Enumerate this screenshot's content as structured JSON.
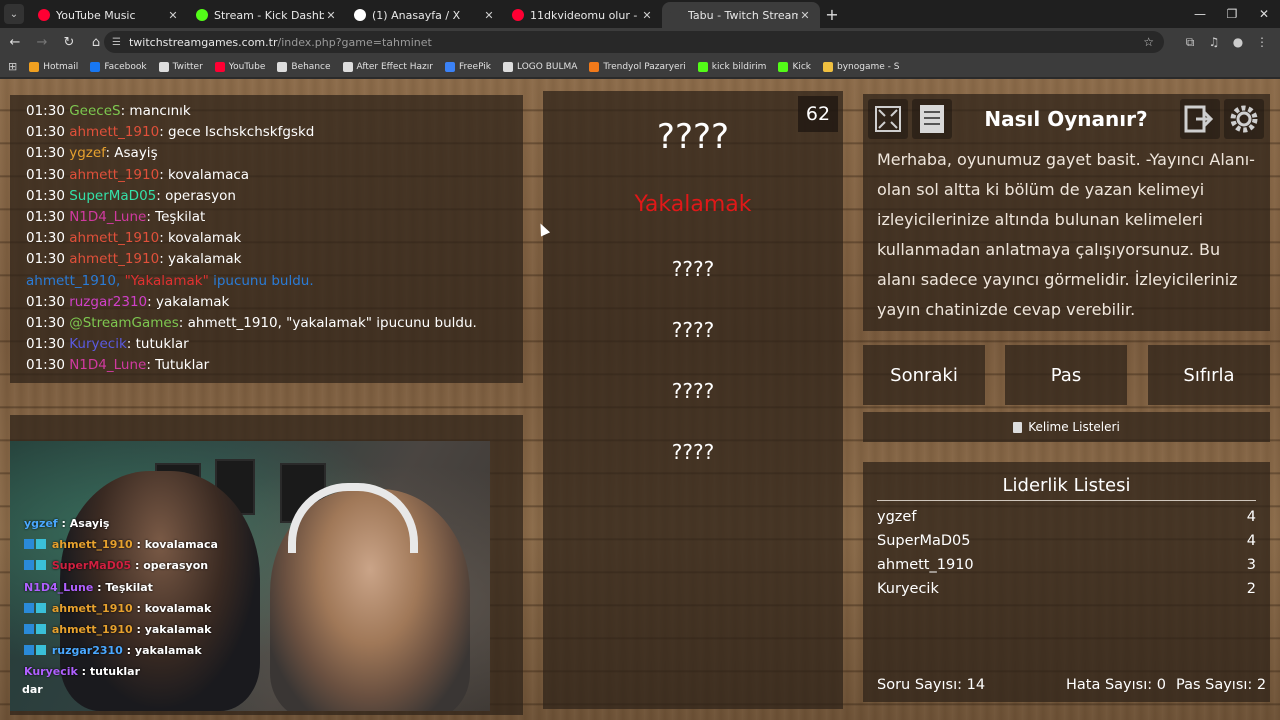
{
  "browser": {
    "tabs": [
      {
        "title": "YouTube Music",
        "color": "#ff0033",
        "active": false
      },
      {
        "title": "Stream - Kick Dashboard",
        "color": "#53fc18",
        "active": false
      },
      {
        "title": "(1) Anasayfa / X",
        "color": "#ffffff",
        "active": false
      },
      {
        "title": "11dkvideomu olur - YouTube",
        "color": "#ff0033",
        "active": false
      },
      {
        "title": "Tabu - Twitch Stream Games",
        "color": "#3c3c3c",
        "active": true
      }
    ],
    "url_host": "twitchstreamgames.com.tr",
    "url_path": "/index.php?game=tahminet",
    "bookmarks": [
      {
        "label": "Hotmail",
        "color": "#f0a020"
      },
      {
        "label": "Facebook",
        "color": "#1877f2"
      },
      {
        "label": "Twitter",
        "color": "#dddddd"
      },
      {
        "label": "YouTube",
        "color": "#ff0033"
      },
      {
        "label": "Behance",
        "color": "#dddddd"
      },
      {
        "label": "After Effect Hazır",
        "color": "#dddddd"
      },
      {
        "label": "FreePik",
        "color": "#3b82f6"
      },
      {
        "label": "LOGO BULMA",
        "color": "#dddddd"
      },
      {
        "label": "Trendyol Pazaryeri",
        "color": "#f27a1a"
      },
      {
        "label": "kick bildirim",
        "color": "#53fc18"
      },
      {
        "label": "Kick",
        "color": "#53fc18"
      },
      {
        "label": "bynogame - S",
        "color": "#f0c040"
      }
    ]
  },
  "chat_log": [
    {
      "time": "01:30",
      "user": "GeeceS",
      "color": "#7ec850",
      "message": "mancınık"
    },
    {
      "time": "01:30",
      "user": "ahmett_1910",
      "color": "#e0503a",
      "message": "gece Ischskchskfgskd"
    },
    {
      "time": "01:30",
      "user": "ygzef",
      "color": "#e6a12e",
      "message": "Asayiş"
    },
    {
      "time": "01:30",
      "user": "ahmett_1910",
      "color": "#e0503a",
      "message": "kovalamaca"
    },
    {
      "time": "01:30",
      "user": "SuperMaD05",
      "color": "#34e0a8",
      "message": "operasyon"
    },
    {
      "time": "01:30",
      "user": "N1D4_Lune",
      "color": "#d03aa0",
      "message": "Teşkilat"
    },
    {
      "time": "01:30",
      "user": "ahmett_1910",
      "color": "#e0503a",
      "message": "kovalamak"
    },
    {
      "time": "01:30",
      "user": "ahmett_1910",
      "color": "#e0503a",
      "message": "yakalamak"
    }
  ],
  "chat_system": {
    "user": "ahmett_1910,",
    "quote": "\"Yakalamak\"",
    "rest": "ipucunu buldu."
  },
  "chat_log_after": [
    {
      "time": "01:30",
      "user": "ruzgar2310",
      "color": "#d040c8",
      "message": "yakalamak"
    },
    {
      "time": "01:30",
      "user": "@StreamGames",
      "color": "#7ec850",
      "message": "ahmett_1910, \"yakalamak\" ipucunu buldu."
    },
    {
      "time": "01:30",
      "user": "Kuryecik",
      "color": "#5a5ae0",
      "message": "tutuklar"
    },
    {
      "time": "01:30",
      "user": "N1D4_Lune",
      "color": "#d03aa0",
      "message": "Tutuklar"
    }
  ],
  "webcam_chat": [
    {
      "user": "ygzef",
      "color": "#4aa8ff",
      "message": "Asayiş"
    },
    {
      "user": "ahmett_1910",
      "color": "#e6a12e",
      "message": "kovalamaca"
    },
    {
      "user": "SuperMaD05",
      "color": "#d02040",
      "message": "operasyon"
    },
    {
      "user": "N1D4_Lune",
      "color": "#b060ff",
      "message": "Teşkilat"
    },
    {
      "user": "ahmett_1910",
      "color": "#e6a12e",
      "message": "kovalamak"
    },
    {
      "user": "ahmett_1910",
      "color": "#e6a12e",
      "message": "yakalamak"
    },
    {
      "user": "ruzgar2310",
      "color": "#4aa8ff",
      "message": "yakalamak"
    },
    {
      "user": "Kuryecik",
      "color": "#b060ff",
      "message": "tutuklar"
    }
  ],
  "webcam_tail": "dar",
  "card": {
    "timer": "62",
    "main_word": "????",
    "hints": [
      "Yakalamak",
      "????",
      "????",
      "????",
      "????"
    ],
    "found_color": "#e01818"
  },
  "info": {
    "title": "Nasıl Oynanır?",
    "text": "Merhaba, oyunumuz gayet basit. -Yayıncı Alanı- olan sol altta ki bölüm de yazan kelimeyi izleyicilerinize altında bulunan kelimeleri kullanmadan anlatmaya çalışıyorsunuz. Bu alanı sadece yayıncı görmelidir. İzleyicileriniz yayın chatinizde cevap verebilir."
  },
  "actions": {
    "next": "Sonraki",
    "pass": "Pas",
    "reset": "Sıfırla",
    "lists": "Kelime Listeleri"
  },
  "leaderboard": {
    "title": "Liderlik Listesi",
    "rows": [
      {
        "name": "ygzef",
        "score": "4"
      },
      {
        "name": "SuperMaD05",
        "score": "4"
      },
      {
        "name": "ahmett_1910",
        "score": "3"
      },
      {
        "name": "Kuryecik",
        "score": "2"
      }
    ]
  },
  "stats": {
    "questions": "Soru Sayısı: 14",
    "errors": "Hata Sayısı: 0",
    "passes": "Pas Sayısı: 2"
  }
}
